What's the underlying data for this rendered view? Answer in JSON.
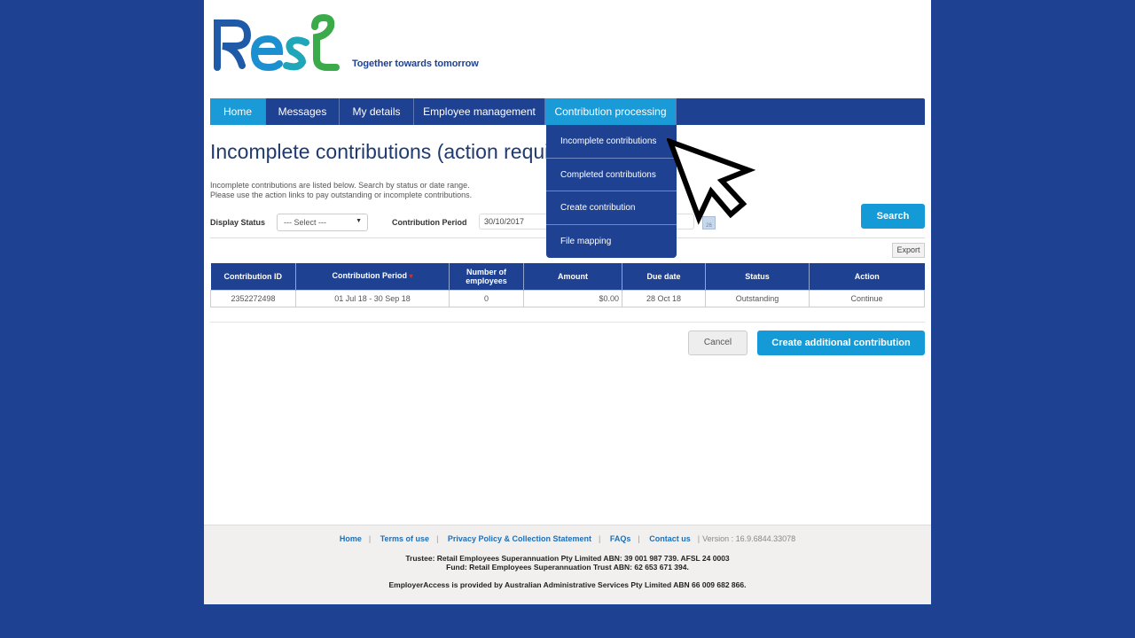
{
  "brand": {
    "logo_text": "Rest",
    "tagline": "Together towards tomorrow",
    "colors": {
      "navy": "#1f4192",
      "accent": "#1a9ad6",
      "green": "#3aaa4a"
    }
  },
  "nav": {
    "items": [
      {
        "label": "Home",
        "active": false
      },
      {
        "label": "Messages"
      },
      {
        "label": "My details"
      },
      {
        "label": "Employee management"
      },
      {
        "label": "Contribution processing",
        "active": true
      }
    ]
  },
  "dropdown": {
    "items": [
      {
        "label": "Incomplete contributions"
      },
      {
        "label": "Completed contributions"
      },
      {
        "label": "Create contribution"
      },
      {
        "label": "File mapping"
      }
    ]
  },
  "page": {
    "title": "Incomplete contributions (action required)",
    "intro_line1": "Incomplete contributions are listed below. Search by status or date range.",
    "intro_line2": "Please use the action links to pay outstanding or incomplete contributions."
  },
  "filters": {
    "status_label": "Display Status",
    "status_value": "--- Select ---",
    "period_label": "Contribution Period",
    "period_from": "30/10/2017",
    "calendar_icon_text": "26",
    "search_label": "Search",
    "export_label": "Export"
  },
  "table": {
    "columns": [
      "Contribution ID",
      "Contribution Period",
      "Number of employees",
      "Amount",
      "Due date",
      "Status",
      "Action"
    ],
    "sort_indicator": "▾",
    "rows": [
      {
        "id": "2352272498",
        "period": "01 Jul 18 - 30 Sep 18",
        "employees": "0",
        "amount": "$0.00",
        "due": "28 Oct 18",
        "status": "Outstanding",
        "action": "Continue"
      }
    ]
  },
  "actions": {
    "cancel": "Cancel",
    "create": "Create additional contribution"
  },
  "footer": {
    "links": [
      "Home",
      "Terms of use",
      "Privacy Policy & Collection Statement",
      "FAQs",
      "Contact us"
    ],
    "version": "Version : 16.9.6844.33078",
    "trustee": "Trustee: Retail Employees Superannuation Pty Limited ABN: 39 001 987 739. AFSL 24 0003",
    "fund": "Fund: Retail Employees Superannuation Trust ABN: 62 653 671 394.",
    "provider": "EmployerAccess is provided by Australian Administrative Services Pty Limited ABN 66 009 682 866."
  }
}
